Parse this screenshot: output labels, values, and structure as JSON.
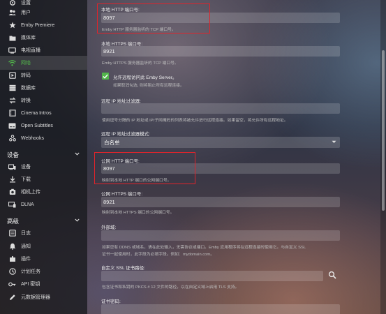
{
  "sidebar": {
    "top_items": [
      {
        "label": "设置",
        "icon": "settings-icon"
      },
      {
        "label": "用户",
        "icon": "people-icon"
      },
      {
        "label": "Emby Premiere",
        "icon": "star-icon"
      },
      {
        "label": "媒体库",
        "icon": "folder-icon"
      },
      {
        "label": "电视直播",
        "icon": "tv-icon"
      },
      {
        "label": "网络",
        "icon": "wifi-icon",
        "active": true
      },
      {
        "label": "转码",
        "icon": "transcode-icon"
      },
      {
        "label": "数据库",
        "icon": "database-icon"
      },
      {
        "label": "转换",
        "icon": "convert-icon"
      },
      {
        "label": "Cinema Intros",
        "icon": "film-icon"
      },
      {
        "label": "Open Subtitles",
        "icon": "subtitles-icon"
      },
      {
        "label": "Webhooks",
        "icon": "webhooks-icon"
      }
    ],
    "devices_section": "设备",
    "devices_items": [
      {
        "label": "设备",
        "icon": "devices-icon"
      },
      {
        "label": "下载",
        "icon": "download-icon"
      },
      {
        "label": "相机上传",
        "icon": "camera-icon"
      },
      {
        "label": "DLNA",
        "icon": "dlna-icon"
      }
    ],
    "advanced_section": "高级",
    "advanced_items": [
      {
        "label": "日志",
        "icon": "log-icon"
      },
      {
        "label": "通知",
        "icon": "bell-icon"
      },
      {
        "label": "插件",
        "icon": "plugin-icon"
      },
      {
        "label": "计划任务",
        "icon": "clock-icon"
      },
      {
        "label": "API 密钥",
        "icon": "key-icon"
      },
      {
        "label": "元数据管理器",
        "icon": "edit-icon"
      }
    ]
  },
  "form": {
    "local_http": {
      "label": "本地 HTTP 端口号:",
      "value": "8097",
      "help": "Emby HTTP 服务器监听的 TCP 端口号。"
    },
    "local_https": {
      "label": "本地 HTTPS 端口号:",
      "value": "8921",
      "help": "Emby HTTPS 服务器监听的 TCP 端口号。"
    },
    "allow_remote": {
      "label": "允许远程访问此 Emby Server。",
      "help": "如果取消勾选, 则将阻止所有远程连接。",
      "checked": true
    },
    "remote_ip_filter": {
      "label": "远程 IP 地址过滤器:",
      "value": "",
      "help": "使用逗号分隔的 IP 地址或 IP/子网掩码的列表将被允许进行远程连接。如果留空，将允许所有远程地址。"
    },
    "remote_ip_filter_mode": {
      "label": "远程 IP 地址过滤器模式:",
      "value": "白名单"
    },
    "public_http": {
      "label": "公网 HTTP 端口号:",
      "value": "8097",
      "help": "映射到本地 HTTP 端口的公网端口号。"
    },
    "public_https": {
      "label": "公网 HTTPS 端口号:",
      "value": "8921",
      "help": "映射到本地 HTTPS 端口的公网端口号。"
    },
    "external_domain": {
      "label": "外部域:",
      "value": "",
      "help_line1": "如果您有 DDNS 或域名，请在此处输入，无需协议或端口。Emby 应用程序将在远程连接时使用它。与自定义 SSL",
      "help_line2": "证书一起使用时，此字段为必填字段。例如：mydomain.com。"
    },
    "ssl_cert_path": {
      "label": "自定义 SSL 证书路径:",
      "value": "",
      "help": "包含证书和私钥的 PKCS # 12 文件的路径，以在自定义域上启用 TLS 支持。"
    },
    "cert_password": {
      "label": "证书密码:"
    }
  }
}
